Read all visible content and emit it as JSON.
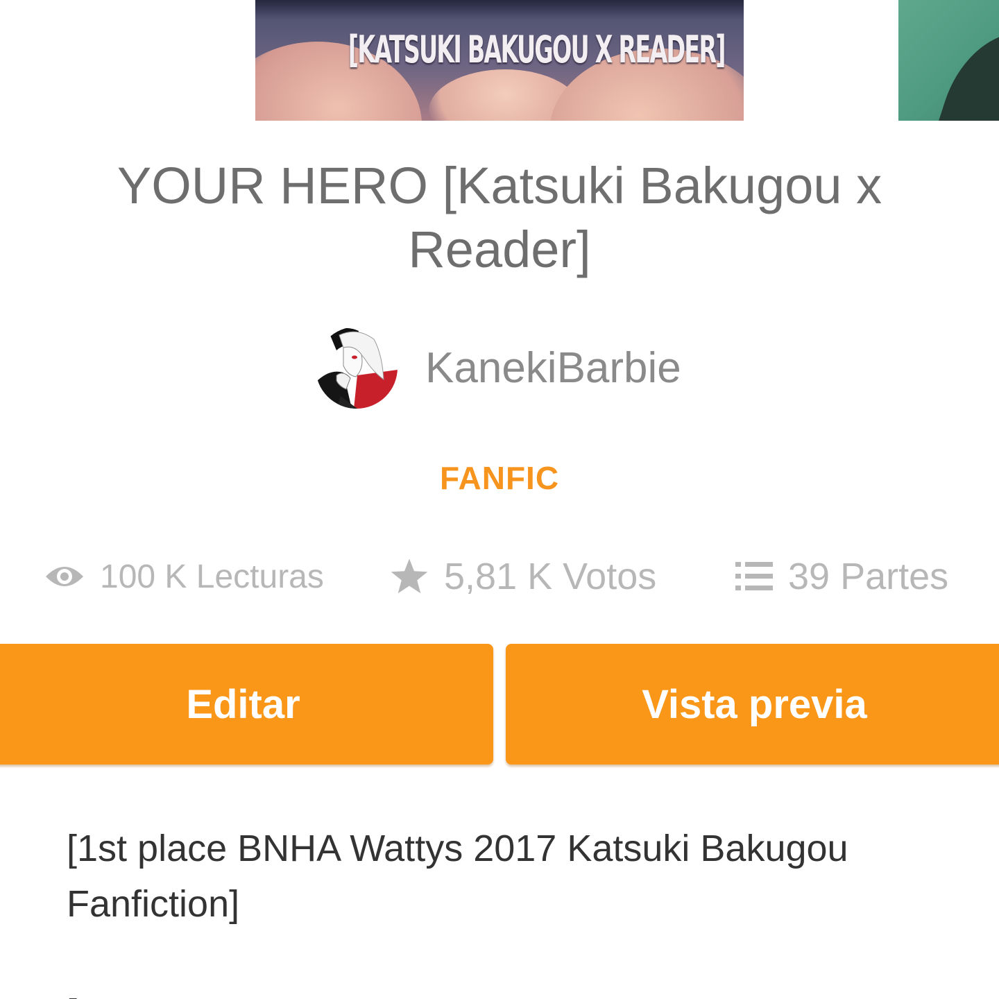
{
  "cover": {
    "text": "[KATSUKI BAKUGOU X READER]"
  },
  "story": {
    "title": "YOUR HERO [Katsuki Bakugou x Reader]",
    "author": "KanekiBarbie",
    "category": "FANFIC"
  },
  "stats": {
    "reads": "100 K Lecturas",
    "votes": "5,81 K Votos",
    "parts": "39 Partes"
  },
  "actions": {
    "edit_label": "Editar",
    "preview_label": "Vista previa"
  },
  "description": {
    "text": "[1st place BNHA Wattys 2017 Katsuki Bakugou Fanfiction]",
    "next_line": "[                                                                              \""
  },
  "icons": {
    "reads": "eye-icon",
    "votes": "star-icon",
    "parts": "list-icon"
  },
  "colors": {
    "accent": "#fa9618",
    "category": "#f7941d",
    "stat_text": "#b7b7b7",
    "title_text": "#6e6e6e"
  }
}
